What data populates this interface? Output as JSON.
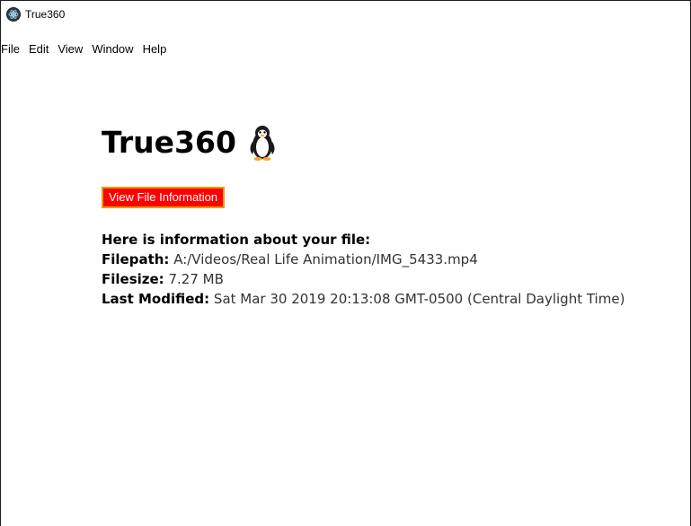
{
  "window": {
    "title": "True360"
  },
  "menu": {
    "items": [
      "File",
      "Edit",
      "View",
      "Window",
      "Help"
    ]
  },
  "main": {
    "heading": "True360",
    "heading_icon": "penguin-icon",
    "button_label": "View File Information",
    "button_colors": {
      "background": "#ff0000",
      "text": "#ffffff",
      "border": "#e0a000"
    },
    "info_header": "Here is information about your file:",
    "filepath_label": "Filepath:",
    "filepath_value": "A:/Videos/Real Life Animation/IMG_5433.mp4",
    "filesize_label": "Filesize:",
    "filesize_value": "7.27 MB",
    "modified_label": "Last Modified:",
    "modified_value": "Sat Mar 30 2019 20:13:08 GMT-0500 (Central Daylight Time)"
  }
}
